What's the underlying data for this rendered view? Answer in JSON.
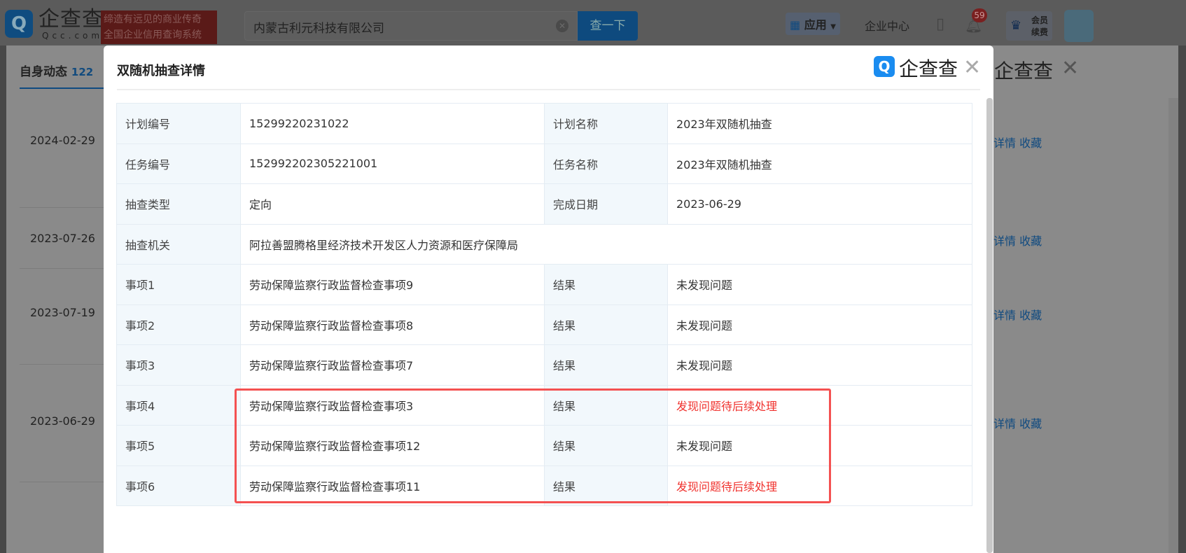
{
  "header": {
    "logo_text": "企查查",
    "logo_sub": "Qcc.com",
    "slogan_1": "缔造有远见的商业传奇",
    "slogan_2": "全国企业信用查询系统",
    "search_value": "内蒙古利元科技有限公司",
    "search_button": "查一下",
    "apps": "应用",
    "enterprise_center": "企业中心",
    "notification_count": "59",
    "vip_1": "会员",
    "vip_2": "续费"
  },
  "background": {
    "tab_label": "自身动态",
    "tab_count": "122",
    "dates": [
      "2024-02-29",
      "2023-07-26",
      "2023-07-19",
      "2023-06-29"
    ],
    "detail_link": "详情",
    "collect_link": "收藏",
    "brand": "企查查"
  },
  "modal": {
    "title": "双随机抽查详情",
    "brand": "企查查",
    "rows": [
      {
        "k1": "计划编号",
        "v1": "15299220231022",
        "k2": "计划名称",
        "v2": "2023年双随机抽查"
      },
      {
        "k1": "任务编号",
        "v1": "152992202305221001",
        "k2": "任务名称",
        "v2": "2023年双随机抽查"
      },
      {
        "k1": "抽查类型",
        "v1": "定向",
        "k2": "完成日期",
        "v2": "2023-06-29"
      },
      {
        "k1": "抽查机关",
        "v1": "阿拉善盟腾格里经济技术开发区人力资源和医疗保障局"
      },
      {
        "k1": "事项1",
        "v1": "劳动保障监察行政监督检查事项9",
        "k2": "结果",
        "v2": "未发现问题"
      },
      {
        "k1": "事项2",
        "v1": "劳动保障监察行政监督检查事项8",
        "k2": "结果",
        "v2": "未发现问题"
      },
      {
        "k1": "事项3",
        "v1": "劳动保障监察行政监督检查事项7",
        "k2": "结果",
        "v2": "未发现问题"
      },
      {
        "k1": "事项4",
        "v1": "劳动保障监察行政监督检查事项3",
        "k2": "结果",
        "v2": "发现问题待后续处理"
      },
      {
        "k1": "事项5",
        "v1": "劳动保障监察行政监督检查事项12",
        "k2": "结果",
        "v2": "未发现问题"
      },
      {
        "k1": "事项6",
        "v1": "劳动保障监察行政监督检查事项11",
        "k2": "结果",
        "v2": "发现问题待后续处理"
      }
    ]
  },
  "colors": {
    "problem": "#f0322e",
    "highlight_box": "#f45151",
    "brand_blue": "#1a8cf0"
  }
}
